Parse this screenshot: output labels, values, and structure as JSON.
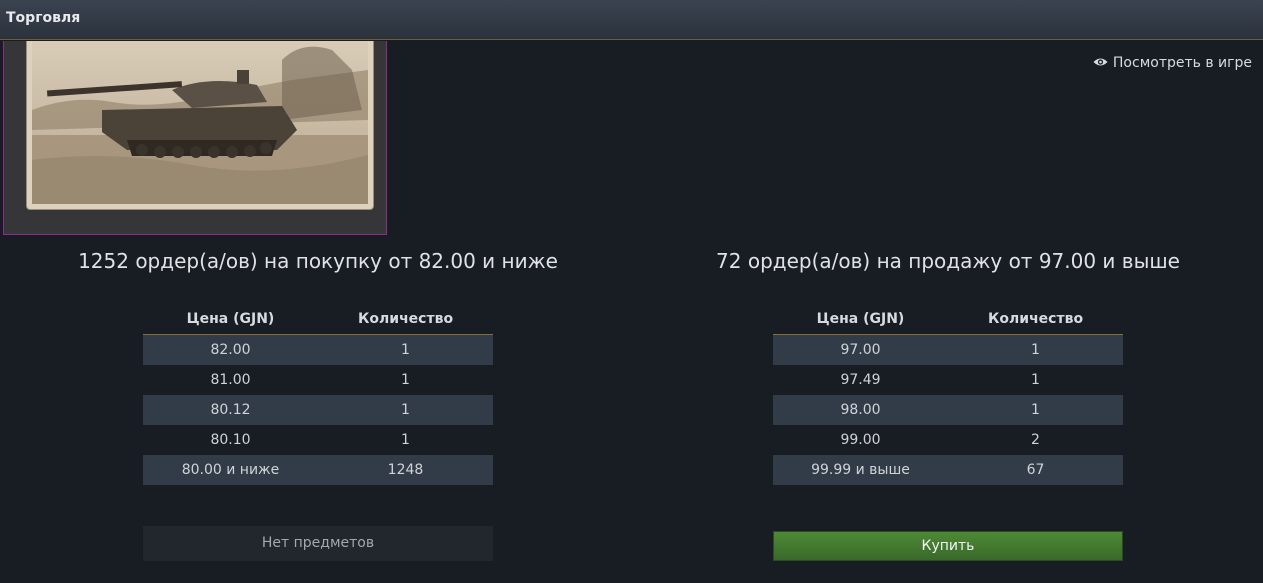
{
  "header": {
    "title": "Торговля"
  },
  "preview": {
    "image": "tank-photo-sepia"
  },
  "view_in_game": {
    "icon": "eye-icon",
    "label": "Посмотреть в игре"
  },
  "buy_orders": {
    "summary": "1252 ордер(а/ов) на покупку от 82.00 и ниже",
    "columns": [
      "Цена (GJN)",
      "Количество"
    ],
    "rows": [
      [
        "82.00",
        "1"
      ],
      [
        "81.00",
        "1"
      ],
      [
        "80.12",
        "1"
      ],
      [
        "80.10",
        "1"
      ],
      [
        "80.00 и ниже",
        "1248"
      ]
    ],
    "button_label": "Нет предметов"
  },
  "sell_orders": {
    "summary": "72 ордер(а/ов) на продажу от 97.00 и выше",
    "columns": [
      "Цена (GJN)",
      "Количество"
    ],
    "rows": [
      [
        "97.00",
        "1"
      ],
      [
        "97.49",
        "1"
      ],
      [
        "98.00",
        "1"
      ],
      [
        "99.00",
        "2"
      ],
      [
        "99.99 и выше",
        "67"
      ]
    ],
    "button_label": "Купить"
  },
  "colors": {
    "accent_green": "#4d8a35",
    "row_alt": "#323c48",
    "background": "#181c23"
  }
}
